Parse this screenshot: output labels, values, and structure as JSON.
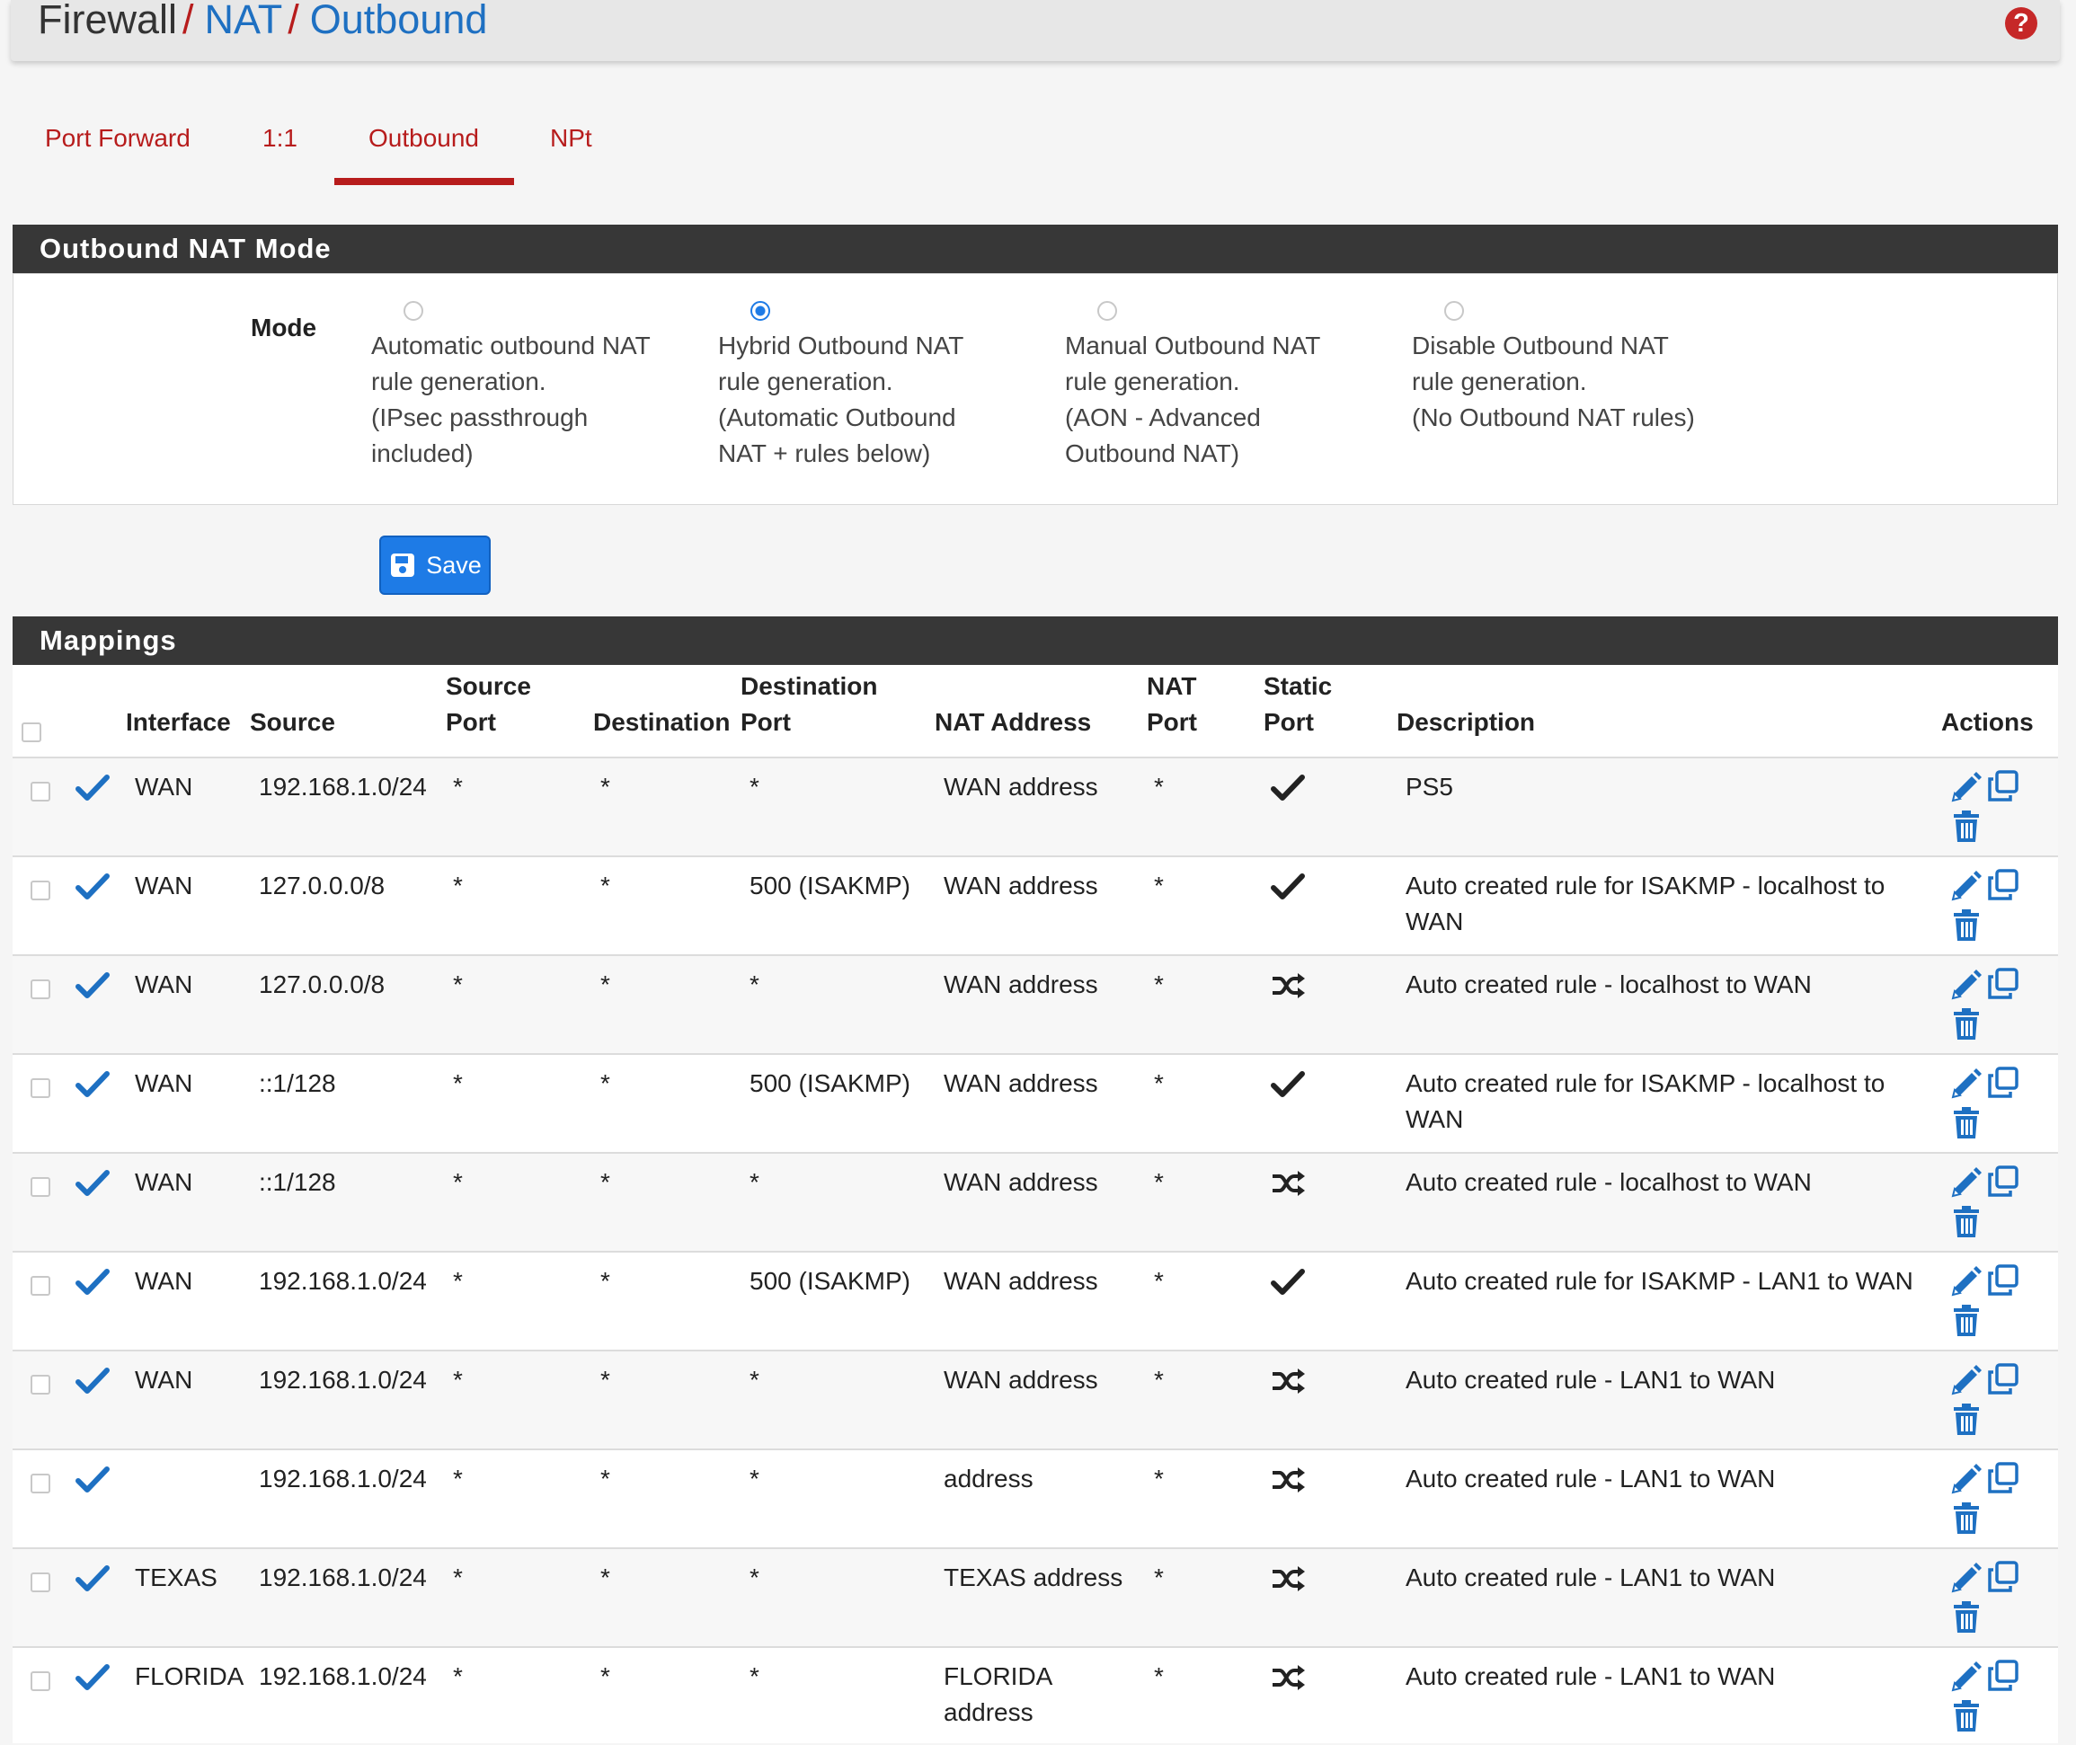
{
  "breadcrumb": {
    "first": "Firewall",
    "second": "NAT",
    "third": "Outbound",
    "sep": "/"
  },
  "help_icon": "?",
  "tabs": [
    {
      "label": "Port Forward",
      "active": false
    },
    {
      "label": "1:1",
      "active": false
    },
    {
      "label": "Outbound",
      "active": true
    },
    {
      "label": "NPt",
      "active": false
    }
  ],
  "mode_panel": {
    "title": "Outbound NAT Mode",
    "label": "Mode",
    "options": [
      {
        "lines": [
          "Automatic outbound NAT",
          "rule generation.",
          "(IPsec passthrough",
          "included)"
        ],
        "checked": false
      },
      {
        "lines": [
          "Hybrid Outbound NAT",
          "rule generation.",
          "(Automatic Outbound",
          "NAT + rules below)"
        ],
        "checked": true
      },
      {
        "lines": [
          "Manual Outbound NAT",
          "rule generation.",
          "(AON - Advanced",
          "Outbound NAT)"
        ],
        "checked": false
      },
      {
        "lines": [
          "Disable Outbound NAT",
          "rule generation.",
          "(No Outbound NAT rules)"
        ],
        "checked": false
      }
    ]
  },
  "save_label": "Save",
  "mappings": {
    "title": "Mappings",
    "headers": {
      "interface": "Interface",
      "source": "Source",
      "source_port_1": "Source",
      "source_port_2": "Port",
      "destination": "Destination",
      "dest_port_1": "Destination",
      "dest_port_2": "Port",
      "nat_address": "NAT Address",
      "nat_port_1": "NAT",
      "nat_port_2": "Port",
      "static_port_1": "Static",
      "static_port_2": "Port",
      "description": "Description",
      "actions": "Actions"
    },
    "rows": [
      {
        "interface": "WAN",
        "source": "192.168.1.0/24",
        "source_port": "*",
        "destination": "*",
        "dest_port": "*",
        "nat_address": [
          "WAN address"
        ],
        "nat_port": "*",
        "static": "check",
        "description": [
          "PS5"
        ]
      },
      {
        "interface": "WAN",
        "source": "127.0.0.0/8",
        "source_port": "*",
        "destination": "*",
        "dest_port": "500 (ISAKMP)",
        "nat_address": [
          "WAN address"
        ],
        "nat_port": "*",
        "static": "check",
        "description": [
          "Auto created rule for ISAKMP - localhost to",
          "WAN"
        ]
      },
      {
        "interface": "WAN",
        "source": "127.0.0.0/8",
        "source_port": "*",
        "destination": "*",
        "dest_port": "*",
        "nat_address": [
          "WAN address"
        ],
        "nat_port": "*",
        "static": "shuffle",
        "description": [
          "Auto created rule - localhost to WAN"
        ]
      },
      {
        "interface": "WAN",
        "source": "::1/128",
        "source_port": "*",
        "destination": "*",
        "dest_port": "500 (ISAKMP)",
        "nat_address": [
          "WAN address"
        ],
        "nat_port": "*",
        "static": "check",
        "description": [
          "Auto created rule for ISAKMP - localhost to",
          "WAN"
        ]
      },
      {
        "interface": "WAN",
        "source": "::1/128",
        "source_port": "*",
        "destination": "*",
        "dest_port": "*",
        "nat_address": [
          "WAN address"
        ],
        "nat_port": "*",
        "static": "shuffle",
        "description": [
          "Auto created rule - localhost to WAN"
        ]
      },
      {
        "interface": "WAN",
        "source": "192.168.1.0/24",
        "source_port": "*",
        "destination": "*",
        "dest_port": "500 (ISAKMP)",
        "nat_address": [
          "WAN address"
        ],
        "nat_port": "*",
        "static": "check",
        "description": [
          "Auto created rule for ISAKMP - LAN1 to WAN"
        ]
      },
      {
        "interface": "WAN",
        "source": "192.168.1.0/24",
        "source_port": "*",
        "destination": "*",
        "dest_port": "*",
        "nat_address": [
          "WAN address"
        ],
        "nat_port": "*",
        "static": "shuffle",
        "description": [
          "Auto created rule - LAN1 to WAN"
        ]
      },
      {
        "interface": "",
        "source": "192.168.1.0/24",
        "source_port": "*",
        "destination": "*",
        "dest_port": "*",
        "nat_address": [
          "address"
        ],
        "nat_port": "*",
        "static": "shuffle",
        "description": [
          "Auto created rule - LAN1 to WAN"
        ]
      },
      {
        "interface": "TEXAS",
        "source": "192.168.1.0/24",
        "source_port": "*",
        "destination": "*",
        "dest_port": "*",
        "nat_address": [
          "TEXAS address"
        ],
        "nat_port": "*",
        "static": "shuffle",
        "description": [
          "Auto created rule - LAN1 to WAN"
        ]
      },
      {
        "interface": "FLORIDA",
        "source": "192.168.1.0/24",
        "source_port": "*",
        "destination": "*",
        "dest_port": "*",
        "nat_address": [
          "FLORIDA",
          "address"
        ],
        "nat_port": "*",
        "static": "shuffle",
        "description": [
          "Auto created rule - LAN1 to WAN"
        ]
      }
    ]
  },
  "colors": {
    "accent_red": "#b71c1c",
    "link_blue": "#1e70c2",
    "action_blue": "#1e7be6",
    "panel_dark": "#373737"
  },
  "icons": {
    "enabled": "check-icon",
    "static_yes": "check-icon",
    "static_no": "shuffle-icon",
    "edit": "pencil-icon",
    "copy": "copy-icon",
    "delete": "trash-icon"
  }
}
